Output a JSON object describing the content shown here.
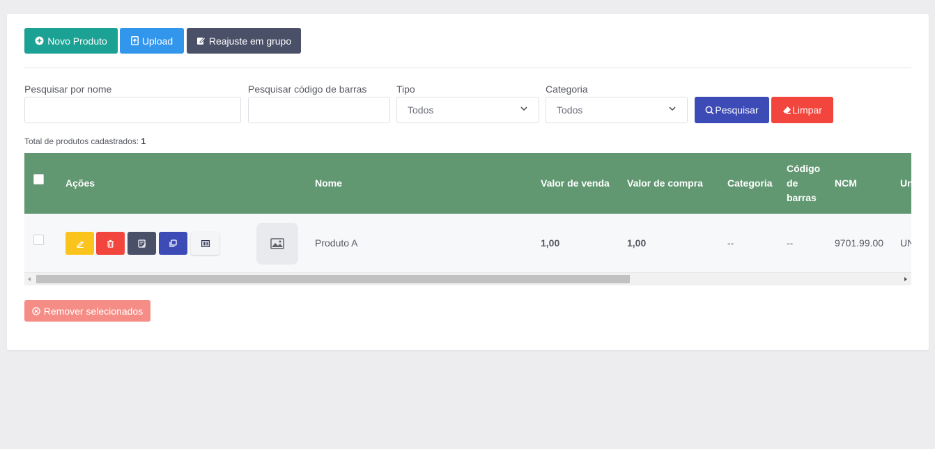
{
  "toolbar": {
    "novo_label": "Novo Produto",
    "upload_label": "Upload",
    "reajuste_label": "Reajuste em grupo"
  },
  "filters": {
    "nome_label": "Pesquisar por nome",
    "nome_value": "",
    "codigo_label": "Pesquisar código de barras",
    "codigo_value": "",
    "tipo_label": "Tipo",
    "tipo_value": "Todos",
    "categoria_label": "Categoria",
    "categoria_value": "Todos",
    "pesquisar_label": "Pesquisar",
    "limpar_label": "Limpar"
  },
  "summary": {
    "total_label": "Total de produtos cadastrados:",
    "total_value": "1"
  },
  "table": {
    "headers": {
      "acoes": "Ações",
      "nome": "Nome",
      "valor_venda": "Valor de venda",
      "valor_compra": "Valor de compra",
      "categoria": "Categoria",
      "codigo_barras_1": "Código",
      "codigo_barras_2": "de",
      "codigo_barras_3": "barras",
      "ncm": "NCM",
      "unidade": "Un"
    },
    "rows": [
      {
        "nome": "Produto A",
        "valor_venda": "1,00",
        "valor_compra": "1,00",
        "categoria": "--",
        "codigo_barras": "--",
        "ncm": "9701.99.00",
        "unidade": "UN"
      }
    ]
  },
  "footer": {
    "remover_label": "Remover selecionados"
  },
  "colors": {
    "primary_green": "#1ba295",
    "upload_blue": "#3296ed",
    "dark_slate": "#4a5068",
    "indigo": "#3d4bb7",
    "danger_red": "#f2453d",
    "warning_yellow": "#fbc41c",
    "table_header_green": "#619871",
    "remover_light_red": "#f58c86"
  },
  "icons": {
    "novo": "plus-circle-icon",
    "upload": "file-upload-icon",
    "reajuste": "notes-icon",
    "pesquisar": "search-icon",
    "limpar": "eraser-icon",
    "edit": "pencil-icon",
    "delete": "trash-icon",
    "note": "note-edit-icon",
    "copy": "copy-icon",
    "barcode": "barcode-icon",
    "thumb": "image-placeholder-icon",
    "remover": "times-circle-icon"
  }
}
